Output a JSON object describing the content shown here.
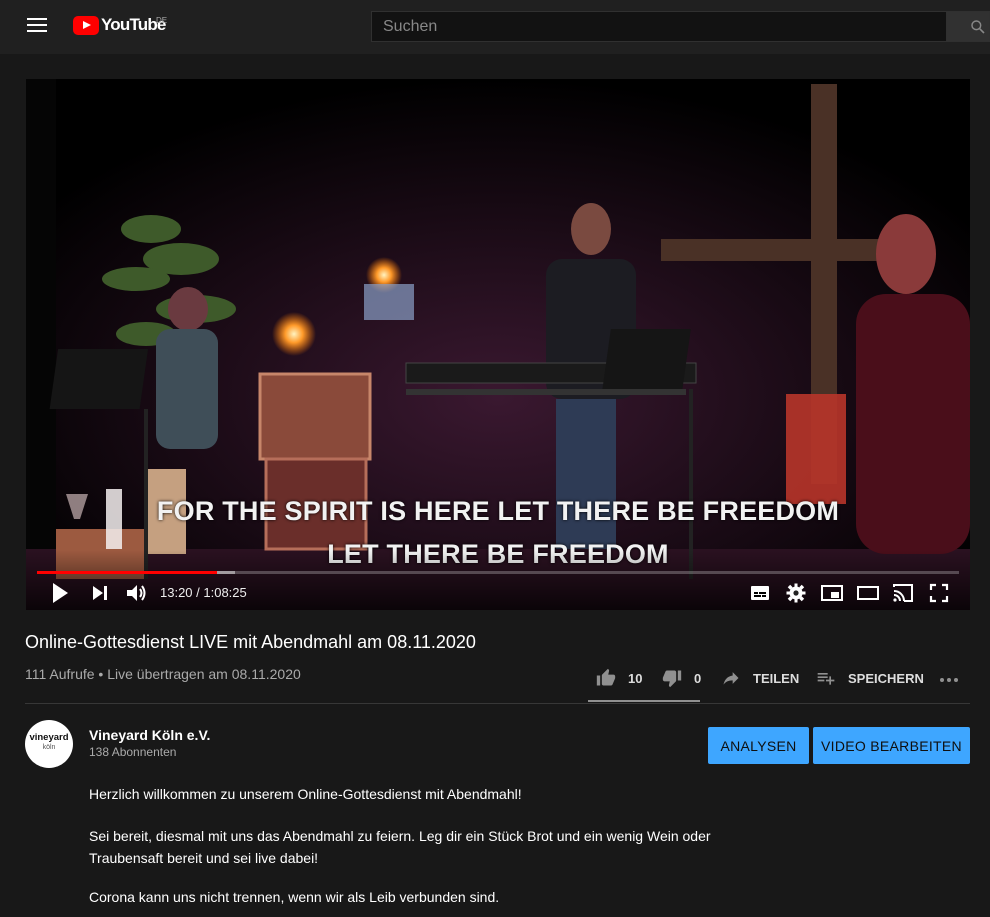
{
  "header": {
    "logo_text": "YouTube",
    "country_code": "DE",
    "search_placeholder": "Suchen"
  },
  "player": {
    "subtitle_line1": "FOR THE SPIRIT IS HERE LET THERE BE FREEDOM",
    "subtitle_line2": "LET THERE BE FREEDOM",
    "time_display": "13:20 / 1:08:25",
    "progress_fraction": 0.195,
    "buffered_fraction": 0.215
  },
  "video": {
    "title": "Online-Gottesdienst LIVE mit Abendmahl am 08.11.2020",
    "meta": "111 Aufrufe • Live übertragen am 08.11.2020"
  },
  "actions": {
    "likes": "10",
    "dislikes": "0",
    "share_label": "TEILEN",
    "save_label": "SPEICHERN"
  },
  "channel": {
    "name": "Vineyard Köln e.V.",
    "subscribers": "138 Abonnenten",
    "avatar_line1": "vineyard",
    "avatar_line2": "köln"
  },
  "buttons": {
    "analytics_label": "ANALYSEN",
    "edit_label": "VIDEO BEARBEITEN"
  },
  "description": {
    "line1": "Herzlich willkommen zu unserem Online-Gottesdienst mit Abendmahl!",
    "line2": "Sei bereit, diesmal mit uns das Abendmahl zu feiern. Leg dir ein Stück Brot und ein wenig Wein oder",
    "line3": "Traubensaft bereit und sei live dabei!",
    "line4": "Corona kann uns nicht trennen, wenn wir als Leib verbunden sind."
  },
  "colors": {
    "brand_red": "#ff0000",
    "accent_blue": "#3ea6ff",
    "background": "#181818"
  }
}
